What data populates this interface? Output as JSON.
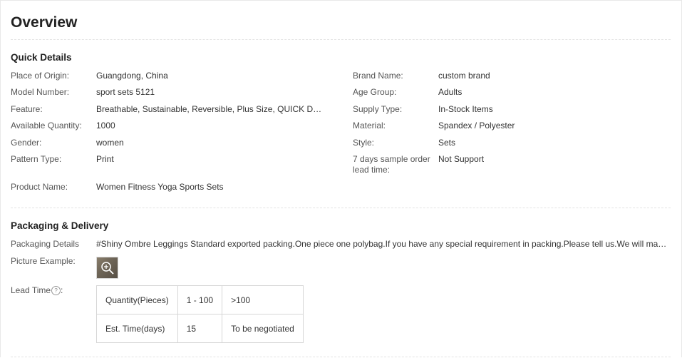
{
  "overview": {
    "title": "Overview"
  },
  "quick_details": {
    "title": "Quick Details",
    "left": [
      {
        "label": "Place of Origin:",
        "value": "Guangdong, China"
      },
      {
        "label": "Model Number:",
        "value": "sport sets 5121"
      },
      {
        "label": "Feature:",
        "value": "Breathable, Sustainable, Reversible, Plus Size, QUICK DRY, Anti-UV, Anti-Bacterial"
      },
      {
        "label": "Available Quantity:",
        "value": "1000"
      },
      {
        "label": "Gender:",
        "value": "women"
      },
      {
        "label": "Pattern Type:",
        "value": "Print"
      },
      {
        "label": "Product Name:",
        "value": "Women Fitness Yoga Sports Sets"
      }
    ],
    "right": [
      {
        "label": "Brand Name:",
        "value": "custom brand"
      },
      {
        "label": "Age Group:",
        "value": "Adults"
      },
      {
        "label": "Supply Type:",
        "value": "In-Stock Items"
      },
      {
        "label": "Material:",
        "value": "Spandex / Polyester"
      },
      {
        "label": "Style:",
        "value": "Sets"
      },
      {
        "label": "7 days sample order lead time:",
        "value": "Not Support"
      }
    ]
  },
  "packaging": {
    "title": "Packaging & Delivery",
    "details_label": "Packaging Details",
    "details_value": "#Shiny Ombre Leggings Standard exported packing.One piece one polybag.If you have any special requirement in packing.Please tell us.We will make the packing according to your requirement.",
    "picture_label": "Picture Example:",
    "lead_time_label": "Lead Time",
    "help_icon": "?",
    "lead_table": {
      "rows": [
        [
          "Quantity(Pieces)",
          "1 - 100",
          ">100"
        ],
        [
          "Est. Time(days)",
          "15",
          "To be negotiated"
        ]
      ]
    }
  }
}
